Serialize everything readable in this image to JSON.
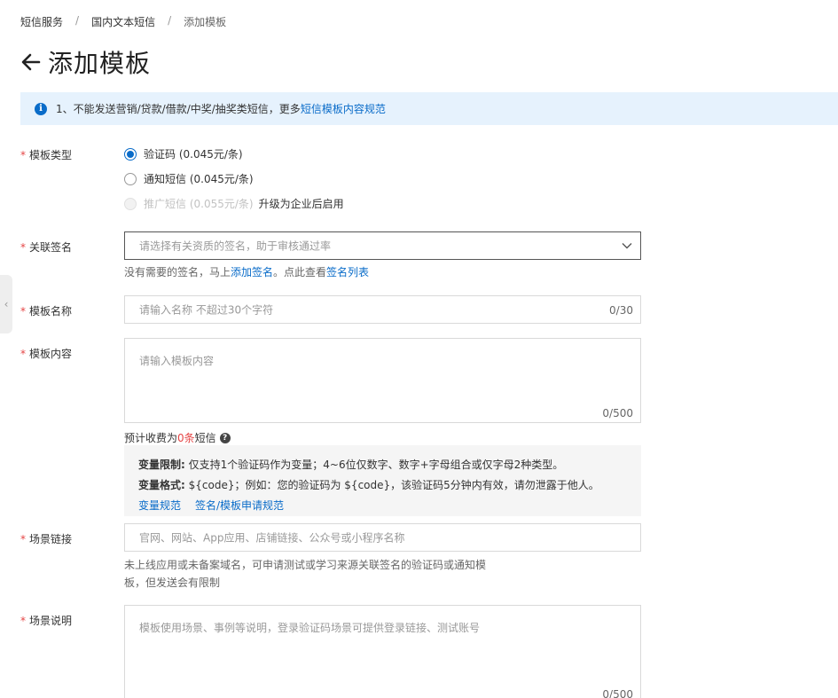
{
  "breadcrumb": [
    "短信服务",
    "国内文本短信",
    "添加模板"
  ],
  "page_title": "添加模板",
  "notice": {
    "text": "1、不能发送营销/贷款/借款/中奖/抽奖类短信，更多",
    "link": "短信模板内容规范"
  },
  "template_type": {
    "label": "模板类型",
    "options": [
      {
        "text": "验证码 (0.045元/条)",
        "checked": true,
        "disabled": false
      },
      {
        "text": "通知短信 (0.045元/条)",
        "checked": false,
        "disabled": false
      },
      {
        "text": "推广短信 (0.055元/条)",
        "checked": false,
        "disabled": true,
        "note": "升级为企业后启用"
      }
    ]
  },
  "signature": {
    "label": "关联签名",
    "placeholder": "请选择有关资质的签名，助于审核通过率",
    "help_prefix": "没有需要的签名，马上",
    "help_link1": "添加签名",
    "help_mid": "。点此查看",
    "help_link2": "签名列表"
  },
  "template_name": {
    "label": "模板名称",
    "placeholder": "请输入名称 不超过30个字符",
    "counter": "0/30"
  },
  "template_content": {
    "label": "模板内容",
    "placeholder": "请输入模板内容",
    "counter": "0/500",
    "fee_prefix": "预计收费为",
    "fee_count": "0条",
    "fee_suffix": "短信",
    "var_limit_label": "变量限制:",
    "var_limit_text": "仅支持1个验证码作为变量；4~6位仅数字、数字+字母组合或仅字母2种类型。",
    "var_format_label": "变量格式:",
    "var_format_text": "${code}；例如：您的验证码为 ${code}，该验证码5分钟内有效，请勿泄露于他人。",
    "link1": "变量规范",
    "link2": "签名/模板申请规范"
  },
  "scene_link": {
    "label": "场景链接",
    "placeholder": "官网、网站、App应用、店铺链接、公众号或小程序名称",
    "help_line1": "未上线应用或未备案域名，可申请测试或学习来源关联签名的验证码或通知模",
    "help_line2": "板，但发送会有限制"
  },
  "scene_desc": {
    "label": "场景说明",
    "placeholder": "模板使用场景、事例等说明，登录验证码场景可提供登录链接、测试账号",
    "counter": "0/500"
  },
  "required_mark": "*"
}
